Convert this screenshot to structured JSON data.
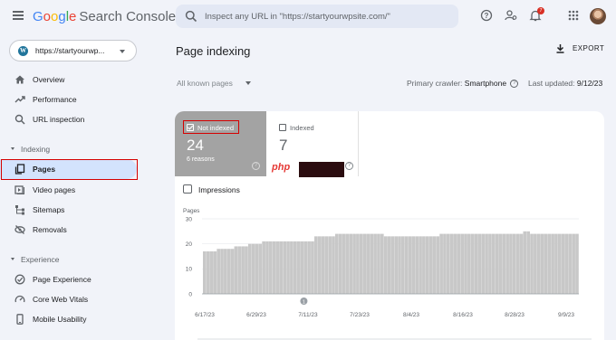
{
  "header": {
    "logo_google": "Google",
    "logo_product": "Search Console",
    "search_placeholder": "Inspect any URL in \"https://startyourwpsite.com/\"",
    "notification_count": "7"
  },
  "sidebar": {
    "property": "https://startyourwp...",
    "items": [
      {
        "label": "Overview",
        "icon": "home-icon"
      },
      {
        "label": "Performance",
        "icon": "trending-up-icon"
      },
      {
        "label": "URL inspection",
        "icon": "search-icon"
      }
    ],
    "sections": [
      {
        "title": "Indexing",
        "items": [
          {
            "label": "Pages",
            "icon": "pages-icon",
            "active": true
          },
          {
            "label": "Video pages",
            "icon": "video-icon"
          },
          {
            "label": "Sitemaps",
            "icon": "sitemap-icon"
          },
          {
            "label": "Removals",
            "icon": "removals-icon"
          }
        ]
      },
      {
        "title": "Experience",
        "items": [
          {
            "label": "Page Experience",
            "icon": "page-experience-icon"
          },
          {
            "label": "Core Web Vitals",
            "icon": "gauge-icon"
          },
          {
            "label": "Mobile Usability",
            "icon": "phone-icon"
          }
        ]
      }
    ]
  },
  "main": {
    "title": "Page indexing",
    "export_label": "EXPORT",
    "filter_value": "All known pages",
    "crawler_label": "Primary crawler:",
    "crawler_value": "Smartphone",
    "updated_label": "Last updated:",
    "updated_value": "9/12/23",
    "tiles": [
      {
        "label": "Not indexed",
        "count": "24",
        "sub": "6 reasons",
        "selected": true
      },
      {
        "label": "Indexed",
        "count": "7",
        "selected": false
      }
    ],
    "impressions_label": "Impressions",
    "watermark": "php"
  },
  "colors": {
    "accent_active": "#d3e3fd",
    "tile_not_indexed": "#a3a3a3",
    "bar_color": "#c8c8c8",
    "highlight_red": "#d50000"
  },
  "chart_data": {
    "type": "bar",
    "ylabel": "Pages",
    "ylim": [
      0,
      30
    ],
    "yticks": [
      0,
      10,
      20,
      30
    ],
    "xtick_labels": [
      "6/17/23",
      "6/29/23",
      "7/11/23",
      "7/23/23",
      "8/4/23",
      "8/16/23",
      "8/28/23",
      "9/9/23"
    ],
    "annotation": "1",
    "values": [
      17,
      17,
      17,
      17,
      18,
      18,
      18,
      18,
      18,
      19,
      19,
      19,
      19,
      20,
      20,
      20,
      20,
      21,
      21,
      21,
      21,
      21,
      21,
      21,
      21,
      21,
      21,
      21,
      21,
      21,
      21,
      21,
      23,
      23,
      23,
      23,
      23,
      23,
      24,
      24,
      24,
      24,
      24,
      24,
      24,
      24,
      24,
      24,
      24,
      24,
      24,
      24,
      23,
      23,
      23,
      23,
      23,
      23,
      23,
      23,
      23,
      23,
      23,
      23,
      23,
      23,
      23,
      23,
      24,
      24,
      24,
      24,
      24,
      24,
      24,
      24,
      24,
      24,
      24,
      24,
      24,
      24,
      24,
      24,
      24,
      24,
      24,
      24,
      24,
      24,
      24,
      24,
      25,
      25,
      24,
      24,
      24,
      24,
      24,
      24,
      24,
      24,
      24,
      24,
      24,
      24,
      24,
      24
    ]
  }
}
